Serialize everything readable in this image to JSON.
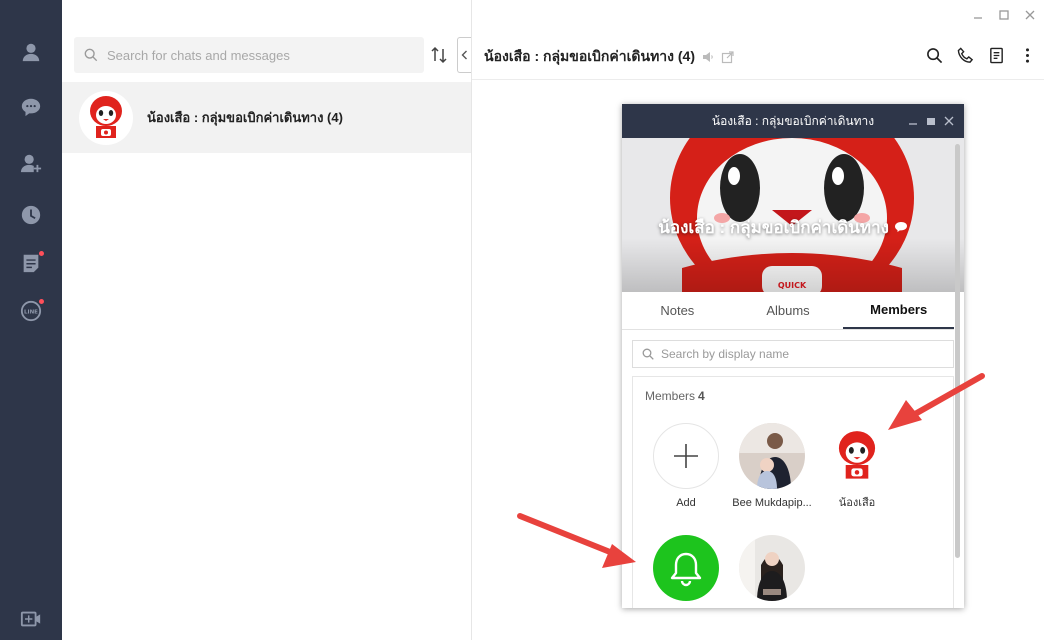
{
  "sidebar": {
    "icons": [
      "friends-icon",
      "chats-icon",
      "add-friend-icon",
      "timeline-icon",
      "notes-icon",
      "line-icon"
    ],
    "bottom_icon": "new-call-icon",
    "badge_color": "#ff4f5a",
    "bg": "#2e3649"
  },
  "chat_list": {
    "search_placeholder": "Search for chats and messages",
    "items": [
      {
        "name": "น้องเสือ : กลุ่มขอเบิกค่าเดินทาง (4)"
      }
    ]
  },
  "chat_header": {
    "title": "น้องเสือ : กลุ่มขอเบิกค่าเดินทาง (4)"
  },
  "group_popup": {
    "window_title": "น้องเสือ : กลุ่มขอเบิกค่าเดินทาง",
    "cover_title": "น้องเสือ : กลุ่มขอเบิกค่าเดินทาง",
    "cover_badge": "QUICK",
    "tabs": [
      {
        "label": "Notes",
        "active": false
      },
      {
        "label": "Albums",
        "active": false
      },
      {
        "label": "Members",
        "active": true
      }
    ],
    "search_placeholder": "Search by display name",
    "members_label": "Members",
    "members_count": "4",
    "members": [
      {
        "name": "Add"
      },
      {
        "name": "Bee Mukdapip..."
      },
      {
        "name": "น้องเสือ"
      },
      {
        "name": ""
      },
      {
        "name": ""
      }
    ]
  },
  "annotation_color": "#e8423d",
  "accent_green": "#1dc41d"
}
